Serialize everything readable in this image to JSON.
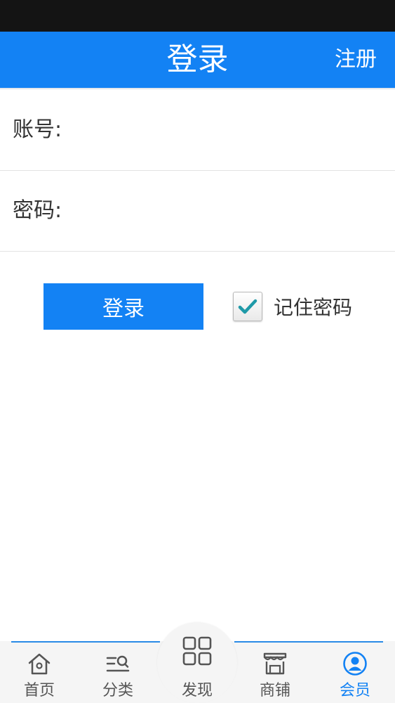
{
  "header": {
    "title": "登录",
    "register_label": "注册"
  },
  "form": {
    "account_label": "账号:",
    "account_value": "",
    "password_label": "密码:",
    "password_value": ""
  },
  "actions": {
    "login_label": "登录",
    "remember_label": "记住密码",
    "remember_checked": true
  },
  "tabbar": {
    "items": [
      {
        "label": "首页",
        "icon": "home-icon"
      },
      {
        "label": "分类",
        "icon": "category-icon"
      },
      {
        "label": "发现",
        "icon": "grid-icon"
      },
      {
        "label": "商铺",
        "icon": "shop-icon"
      },
      {
        "label": "会员",
        "icon": "user-icon",
        "active": true
      }
    ]
  },
  "colors": {
    "primary": "#1382f4",
    "status_bar": "#141414",
    "text": "#333333",
    "check": "#1f9aa8"
  }
}
